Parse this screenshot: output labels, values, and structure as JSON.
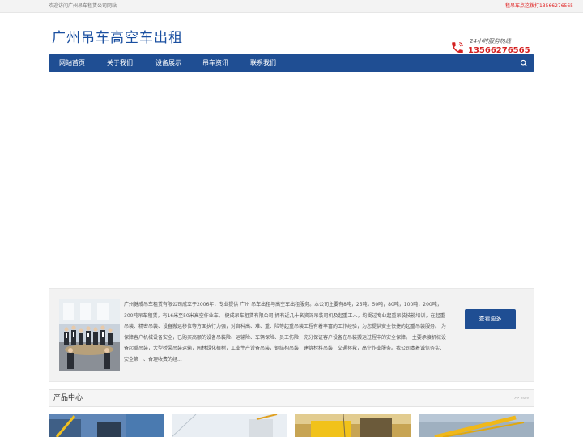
{
  "topbar": {
    "welcome": "欢迎访问广州吊车租赁公司网站",
    "hotcall": "租吊车点这拨打13566276565"
  },
  "header": {
    "logo_text": "广州吊车高空车出租",
    "hotline_label": "24小时服务热线",
    "hotline_number": "13566276565",
    "accent_color": "#1f4e93",
    "hotline_color": "#d42020"
  },
  "nav": {
    "items": [
      "网站首页",
      "关于我们",
      "设备展示",
      "吊车资讯",
      "联系我们"
    ],
    "search_icon": "search-icon"
  },
  "about": {
    "text": "广州健成吊车租赁有限公司成立于2006年，专业提供 广州 吊车出租与高空车出租服务。本公司主要有8吨，25吨，50吨，80吨，100吨，200吨，300吨吊车租赁，有16米至50米高空作业车。 健成吊车租赁有限公司 拥有近几十名资深吊装司机及起重工人，均受过专业起重吊装技能培训，在起重吊装、精密吊装、设备搬运移位等方面执行力强，对各种高、难、重、险等起重吊装工程有着丰富的工作经验，为您提供安全快捷的起重吊装服务。 为保障客户机械设备安全，已购买高额的设备吊装险、运输险、车辆保险、员工伤险，充分保证客户设备在吊装搬运过程中的安全保障。 主要承接机械设备起重吊装，大型桥梁吊装运输，园林绿化植树，工业生产设备吊装，钢结构吊装，建筑材料吊装，交通拯救，高空作业服务。我公司本着诚信务实、安全第一、合理收费的经...",
    "more_button": "查看更多"
  },
  "products": {
    "title": "产品中心",
    "more": ">> more"
  }
}
